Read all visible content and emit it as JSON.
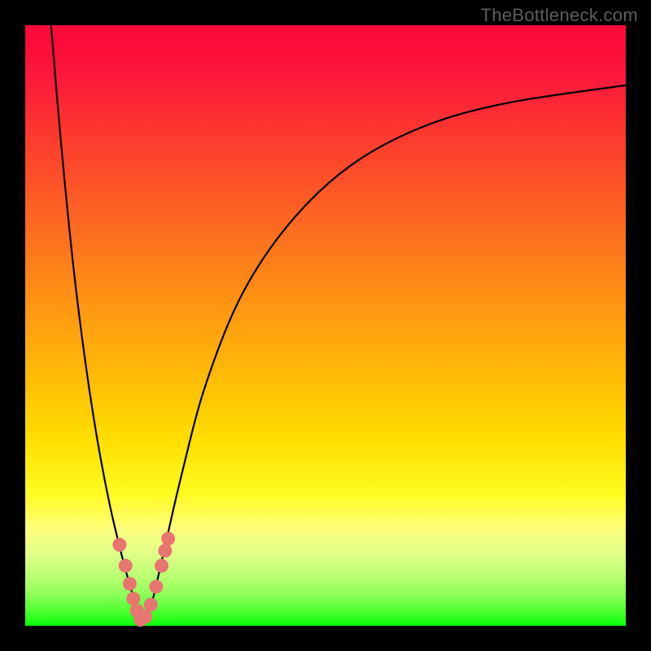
{
  "watermark": "TheBottleneck.com",
  "colors": {
    "frame": "#000000",
    "curve_stroke": "#000000",
    "marker_fill": "#e77571",
    "gradient_top": "#fb0b3a",
    "gradient_bottom": "#07ff08"
  },
  "chart_data": {
    "type": "line",
    "title": "",
    "xlabel": "",
    "ylabel": "",
    "xlim": [
      0,
      100
    ],
    "ylim": [
      0,
      100
    ],
    "series": [
      {
        "name": "left-branch",
        "x": [
          4.3,
          6.0,
          8.0,
          10.0,
          12.0,
          14.0,
          16.0,
          17.5,
          18.8,
          19.6
        ],
        "y": [
          100.0,
          80.0,
          60.0,
          44.0,
          31.0,
          20.5,
          12.0,
          6.5,
          2.5,
          0.3
        ]
      },
      {
        "name": "right-branch",
        "x": [
          19.6,
          21.0,
          23.0,
          26.0,
          30.0,
          36.0,
          44.0,
          54.0,
          66.0,
          80.0,
          100.0
        ],
        "y": [
          0.3,
          3.5,
          12.0,
          25.0,
          40.0,
          55.0,
          67.0,
          76.5,
          83.0,
          87.0,
          90.0
        ]
      }
    ],
    "markers": {
      "name": "highlighted-points",
      "x": [
        15.7,
        16.7,
        17.4,
        18.0,
        18.6,
        19.2,
        20.0,
        20.9,
        21.8,
        22.7,
        23.3,
        23.8
      ],
      "y": [
        13.5,
        10.0,
        7.0,
        4.5,
        2.5,
        1.0,
        1.5,
        3.5,
        6.5,
        10.0,
        12.5,
        14.5
      ]
    }
  }
}
